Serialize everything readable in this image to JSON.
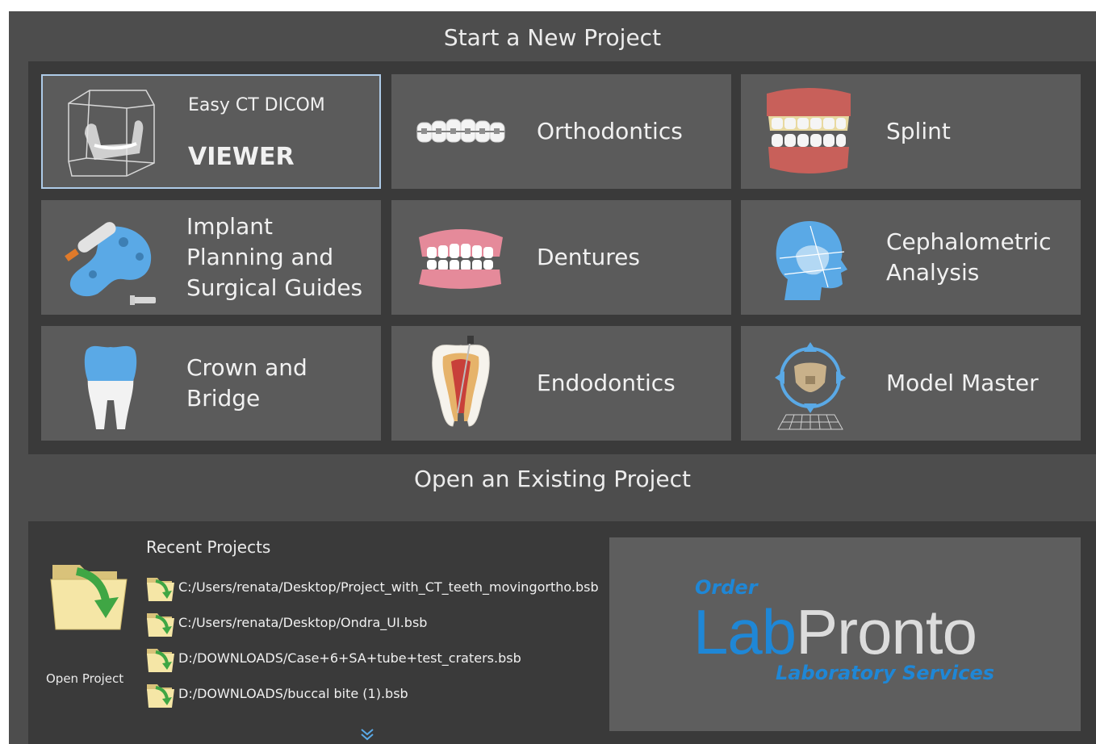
{
  "new_project": {
    "title": "Start a New Project",
    "tiles": [
      {
        "id": "viewer",
        "label_top": "Easy CT DICOM",
        "label_bottom": "VIEWER",
        "icon": "ct-cube-icon",
        "selected": true
      },
      {
        "id": "orthodontics",
        "label": "Orthodontics",
        "icon": "braces-icon"
      },
      {
        "id": "splint",
        "label": "Splint",
        "icon": "splint-jaw-icon"
      },
      {
        "id": "implant",
        "label": "Implant\nPlanning and\nSurgical Guides",
        "icon": "implant-guide-icon"
      },
      {
        "id": "dentures",
        "label": "Dentures",
        "icon": "dentures-icon"
      },
      {
        "id": "cephalometric",
        "label": "Cephalometric\nAnalysis",
        "icon": "skull-profile-icon"
      },
      {
        "id": "crown",
        "label": "Crown and\nBridge",
        "icon": "crown-tooth-icon"
      },
      {
        "id": "endodontics",
        "label": "Endodontics",
        "icon": "endo-tooth-icon"
      },
      {
        "id": "model_master",
        "label": "Model Master",
        "icon": "model-master-icon"
      }
    ]
  },
  "open_project": {
    "title": "Open an Existing Project",
    "open_label": "Open Project",
    "recent_title": "Recent Projects",
    "recent": [
      "C:/Users/renata/Desktop/Project_with_CT_teeth_movingortho.bsb",
      "C:/Users/renata/Desktop/Ondra_UI.bsb",
      "D:/DOWNLOADS/Case+6+SA+tube+test_craters.bsb",
      "D:/DOWNLOADS/buccal bite (1).bsb"
    ]
  },
  "promo": {
    "order": "Order",
    "brand_lab": "Lab",
    "brand_pronto": "Pronto",
    "tagline": "Laboratory Services"
  },
  "colors": {
    "panel_bg": "#4d4d4d",
    "tile_bg": "#5b5b5b",
    "inner_bg": "#3a3a3a",
    "selected_border": "#aecbe8",
    "brand_blue": "#1f87d6",
    "icon_blue": "#5aa9e6"
  }
}
